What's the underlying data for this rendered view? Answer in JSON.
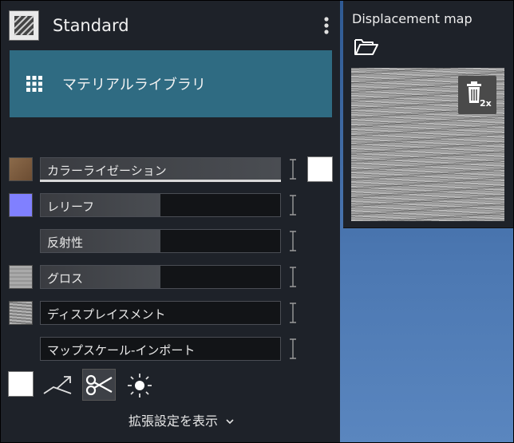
{
  "header": {
    "title": "Standard",
    "menu_icon": "kebab-menu-icon"
  },
  "library_button": {
    "label": "マテリアルライブラリ",
    "icon": "grid-icon"
  },
  "colors": {
    "library_button_bg": "#2f6b82",
    "panel_bg": "#1e2229",
    "viewport_top": "#2f5a93",
    "viewport_bottom": "#5a86bf",
    "colorization_swatch": "#7a5a3e",
    "relief_swatch": "#8080ff"
  },
  "properties": [
    {
      "label": "カラーライゼーション",
      "value": 1.0
    },
    {
      "label": "レリーフ",
      "value": 0.5
    },
    {
      "label": "反射性",
      "value": 0.5
    },
    {
      "label": "グロス",
      "value": 0.5
    },
    {
      "label": "ディスプレイスメント",
      "value": 0.0
    },
    {
      "label": "マップスケール-インポート",
      "value": 0.0
    }
  ],
  "toolbar": {
    "icons": [
      "white-swatch-icon",
      "projection-icon",
      "scissors-icon",
      "brightness-icon"
    ]
  },
  "advanced_toggle": {
    "label": "拡張設定を表示"
  },
  "displacement": {
    "title": "Displacement map",
    "folder_icon": "folder-open-icon",
    "delete_icon": "trash-icon",
    "badge": "2x"
  }
}
